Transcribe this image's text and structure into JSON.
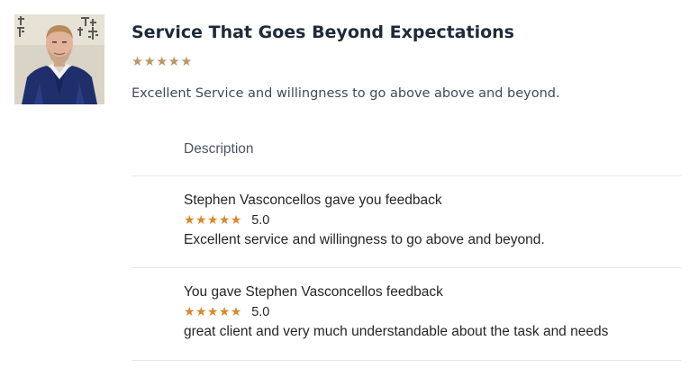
{
  "review": {
    "title": "Service That Goes Beyond Expectations",
    "stars": "★★★★★",
    "text": "Excellent Service and willingness to go above above and beyond."
  },
  "panel": {
    "header": "Description",
    "feedback": [
      {
        "title": "Stephen Vasconcellos gave you feedback",
        "stars": "★★★★★",
        "score": "5.0",
        "comment": "Excellent service and willingness to go above and beyond."
      },
      {
        "title": "You gave Stephen Vasconcellos feedback",
        "stars": "★★★★★",
        "score": "5.0",
        "comment": "great client and very much understandable about the task and needs"
      }
    ]
  },
  "colors": {
    "title": "#1e2a3a",
    "review_star": "#b9976a",
    "feedback_star": "#d9892a",
    "divider": "#e7e7e7"
  },
  "icons": {
    "avatar": "avatar-photo",
    "star": "star-icon"
  }
}
